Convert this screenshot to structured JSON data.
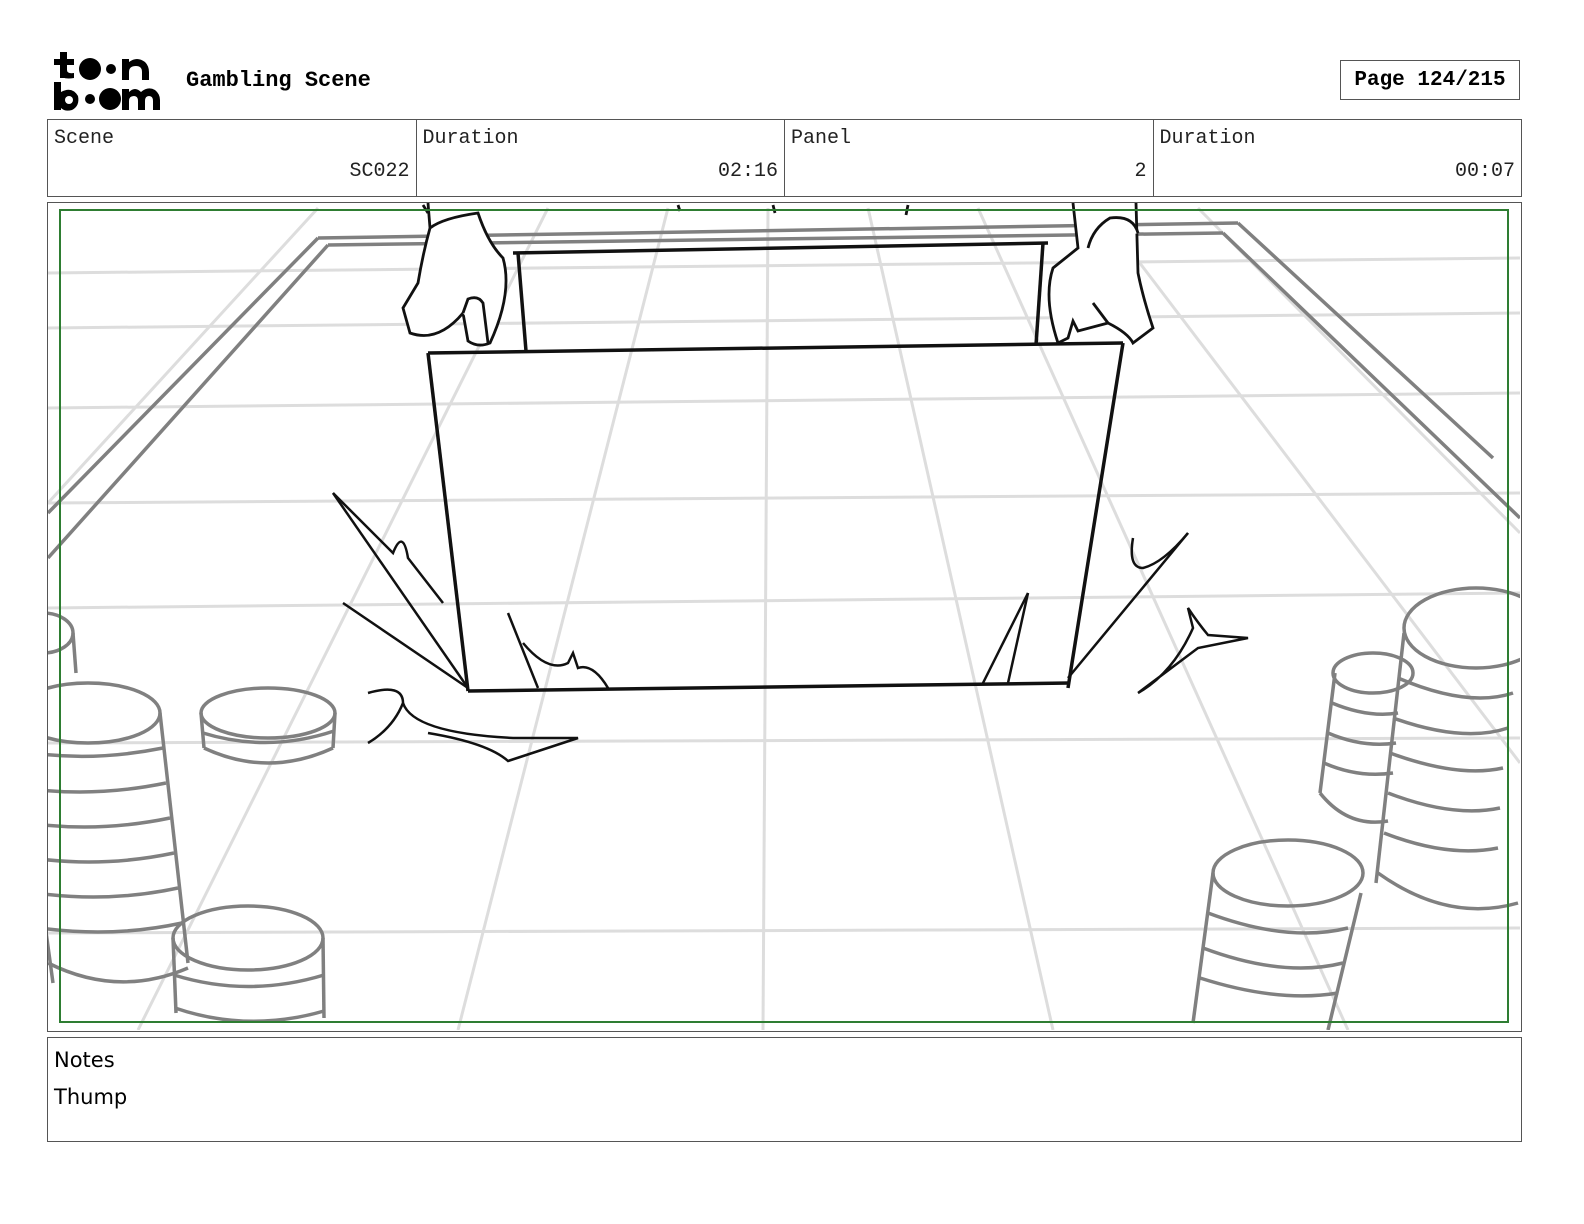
{
  "header": {
    "logo_text": "toon boom",
    "scene_title": "Gambling Scene",
    "page_label": "Page 124/215"
  },
  "info": [
    {
      "label": "Scene",
      "value": "SC022"
    },
    {
      "label": "Duration",
      "value": "02:16"
    },
    {
      "label": "Panel",
      "value": "2"
    },
    {
      "label": "Duration",
      "value": "00:07"
    }
  ],
  "notes": {
    "label": "Notes",
    "text": "Thump"
  },
  "colors": {
    "safe_frame": "#2e7d32",
    "grid": "#dddddd",
    "chips": "#808080",
    "ink": "#111111"
  }
}
